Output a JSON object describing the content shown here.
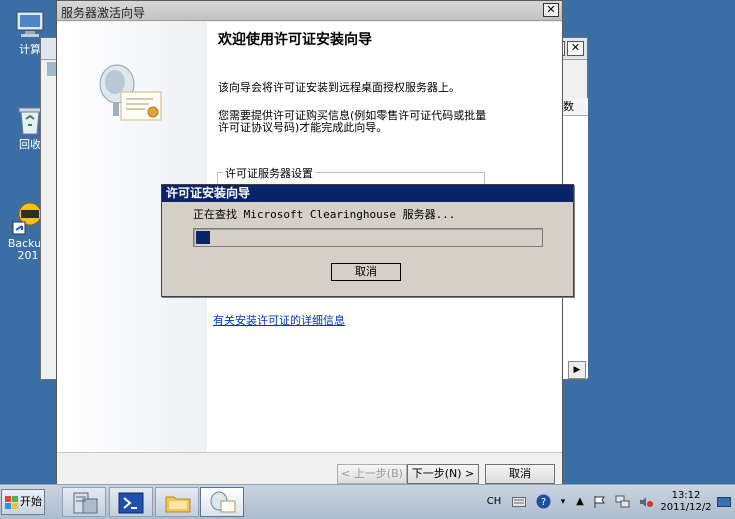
{
  "desktop": {
    "icons": [
      {
        "label": "计算"
      },
      {
        "label": "回收"
      },
      {
        "label": "Backup\n201"
      }
    ]
  },
  "background_window": {
    "column_header": "数"
  },
  "wizard": {
    "title": "服务器激活向导",
    "close_label": "✕",
    "heading": "欢迎使用许可证安装向导",
    "intro": "该向导会将许可证安装到远程桌面授权服务器上。",
    "need_info": "您需要提供许可证购买信息(例如零售许可证代码或批量许可证协议号码)才能完成此向导。",
    "group_title": "许可证服务器设置",
    "link_text": "有关安装许可证的详细信息",
    "buttons": {
      "back": "< 上一步(B)",
      "next": "下一步(N) >",
      "cancel": "取消"
    }
  },
  "progress_dialog": {
    "title": "许可证安装向导",
    "message": "正在查找 Microsoft Clearinghouse 服务器...",
    "progress_fraction": 0.04,
    "cancel": "取消"
  },
  "taskbar": {
    "start_label": "开始",
    "language": "CH",
    "time": "13:12",
    "date": "2011/12/2"
  },
  "colors": {
    "desktop": "#3a6ea5",
    "dialog_title": "#0a246a",
    "progress_fill": "#0a246a"
  }
}
